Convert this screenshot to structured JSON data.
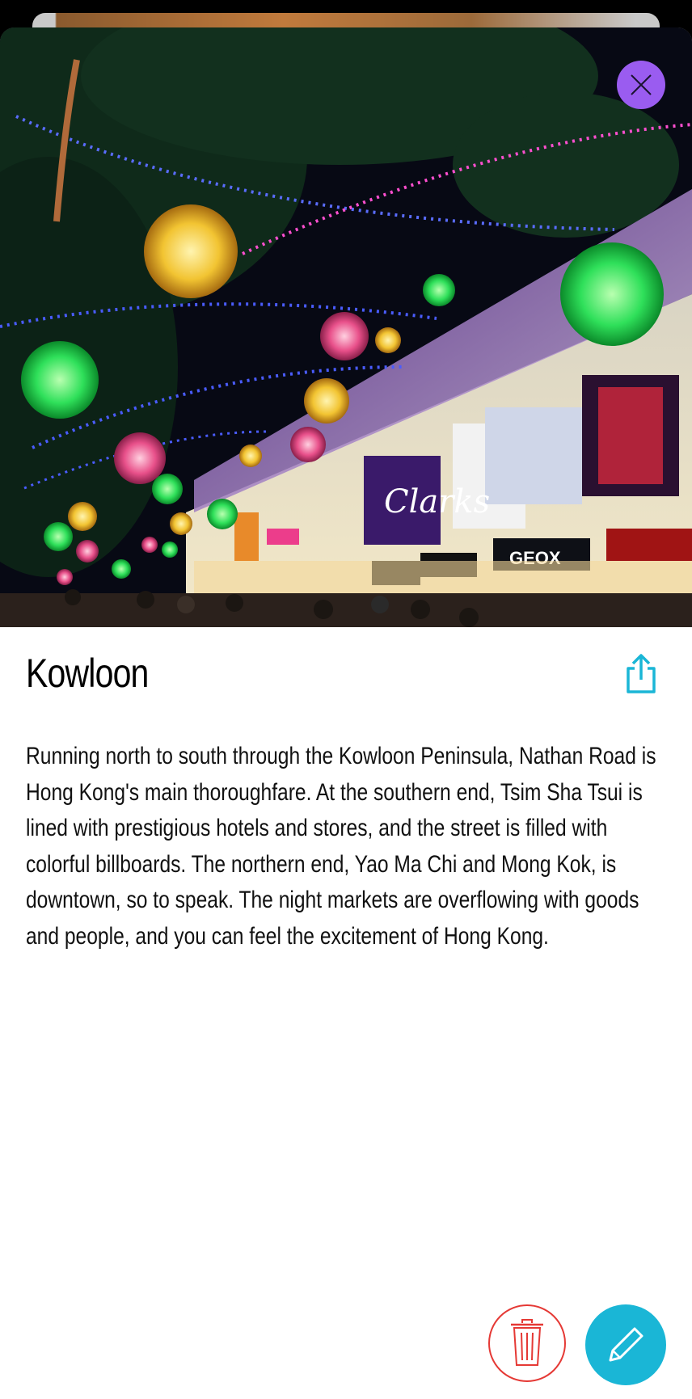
{
  "place": {
    "title": "Kowloon",
    "description": "Running north to south through the Kowloon Peninsula, Nathan Road is Hong Kong's main thoroughfare. At the southern end, Tsim Sha Tsui is lined with prestigious hotels and stores, and the street is filled with colorful billboards. The northern end, Yao Ma Chi and Mong Kok, is downtown, so to speak. The night markets are overflowing with goods and people, and you can feel the excitement of Hong Kong.",
    "photo": {
      "signs": [
        "Clarks",
        "GEOX"
      ]
    }
  },
  "icons": {
    "close": "close-icon",
    "share": "share-icon",
    "delete": "trash-icon",
    "edit": "pencil-icon"
  },
  "colors": {
    "close_button": "#9a5cf0",
    "share_icon": "#1ab6d6",
    "delete_outline": "#e53935",
    "edit_button": "#1ab6d6"
  }
}
